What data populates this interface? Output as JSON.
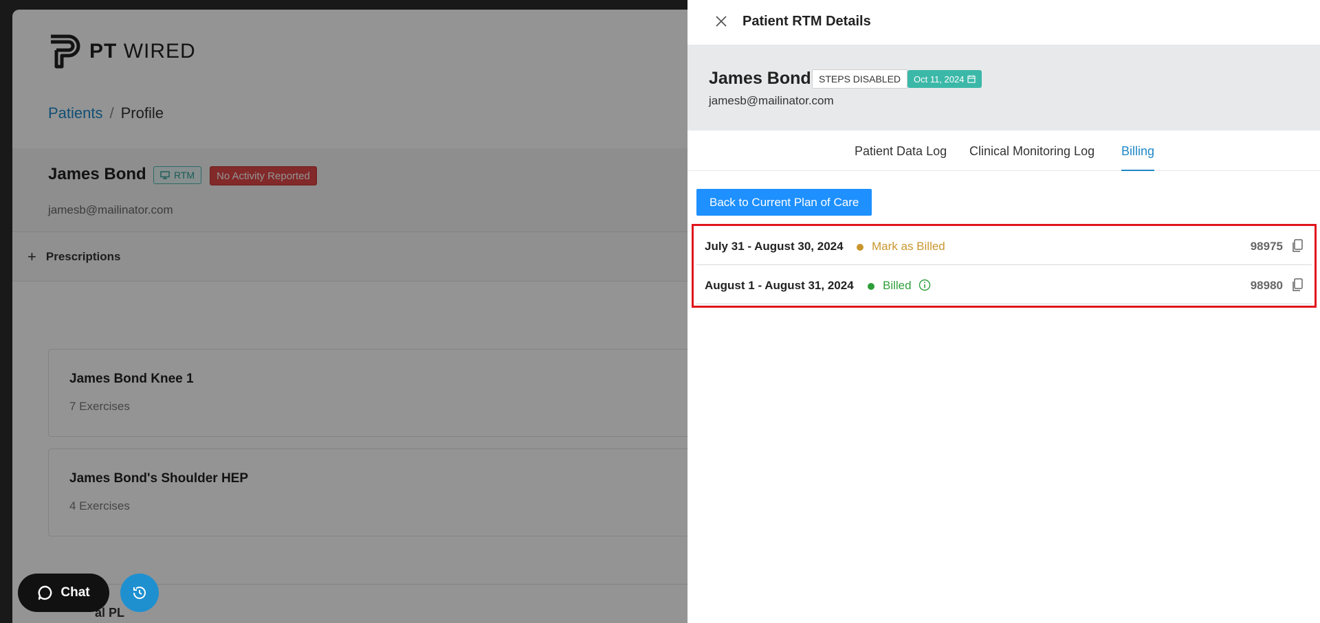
{
  "app": {
    "logo": {
      "bold": "PT",
      "light": "WIRED"
    },
    "breadcrumb": {
      "link": "Patients",
      "separator": "/",
      "current": "Profile"
    },
    "profile": {
      "name": "James Bond",
      "rtm_label": "RTM",
      "activity_badge": "No Activity Reported",
      "email": "jamesb@mailinator.com"
    },
    "prescriptions_label": "Prescriptions",
    "cards": [
      {
        "title": "James Bond Knee 1",
        "subtitle": "7 Exercises"
      },
      {
        "title": "James Bond's Shoulder HEP",
        "subtitle": "4 Exercises"
      }
    ],
    "bottom_text": "al PL",
    "chat_label": "Chat"
  },
  "panel": {
    "title": "Patient RTM Details",
    "patient": {
      "name": "James Bond",
      "steps_badge": "STEPS DISABLED",
      "date_badge": "Oct 11, 2024",
      "email": "jamesb@mailinator.com"
    },
    "tabs": [
      {
        "label": "Patient Data Log"
      },
      {
        "label": "Clinical Monitoring Log"
      },
      {
        "label": "Billing"
      }
    ],
    "active_tab": "Billing",
    "back_button": "Back to Current Plan of Care",
    "billing_rows": [
      {
        "period": "July 31 - August 30, 2024",
        "status": "Mark as Billed",
        "status_color": "#c9962e",
        "code": "98975"
      },
      {
        "period": "August 1 - August 31, 2024",
        "status": "Billed",
        "status_color": "#2e9e3a",
        "code": "98980"
      }
    ]
  },
  "colors": {
    "accent": "#1e88c8",
    "button_blue": "#1e90ff",
    "teal": "#3cb8a8",
    "danger": "#e04848",
    "highlight": "#e0141c"
  }
}
